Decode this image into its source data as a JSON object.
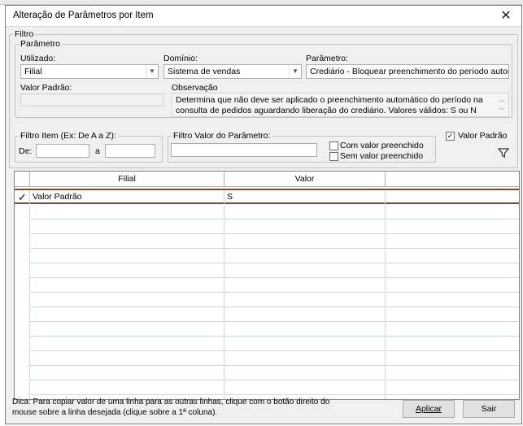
{
  "window": {
    "title": "Alteração de Parâmetros por Item"
  },
  "filtro": {
    "legend": "Filtro",
    "parametro_group": {
      "legend": "Parâmetro",
      "utilizado_label": "Utilizado:",
      "utilizado_value": "Filial",
      "dominio_label": "Domínio:",
      "dominio_value": "Sistema de vendas",
      "parametro_label": "Parâmetro:",
      "parametro_value": "Crediário - Bloquear preenchimento do período automátic",
      "valor_padrao_label": "Valor Padrão:",
      "valor_padrao_value": "",
      "observacao_label": "Observação",
      "observacao_text": "Determina que não deve ser aplicado o preenchimento automático do período na consulta de pedidos aguardando liberação do crediário. Valores válidos: S ou N"
    },
    "filtro_item": {
      "legend": "Filtro Item (Ex: De A a Z):",
      "de_label": "De:",
      "de_value": "",
      "a_label": "a",
      "a_value": ""
    },
    "filtro_valor": {
      "legend": "Filtro Valor do Parâmetro:",
      "value": "",
      "com_valor_label": "Com valor preenchido",
      "com_valor_checked": false,
      "sem_valor_label": "Sem valor preenchido",
      "sem_valor_checked": false
    },
    "valor_padrao_check": {
      "label": "Valor Padrão",
      "checked": true
    }
  },
  "grid": {
    "columns": [
      "Filial",
      "Valor",
      ""
    ],
    "rows": [
      {
        "filial": "Valor Padrão",
        "valor": "S",
        "marker": "✓"
      }
    ],
    "empty_rows": 14
  },
  "footer": {
    "hint": "Dica: Para copiar valor de uma linha para as outras linhas, clique com o botão direito do mouse sobre a linha desejada (clique sobre a 1ª coluna).",
    "aplicar_label": "Aplicar",
    "sair_label": "Sair"
  },
  "icons": {
    "close": "close-icon",
    "filter": "filter-icon",
    "check": "check-icon"
  }
}
